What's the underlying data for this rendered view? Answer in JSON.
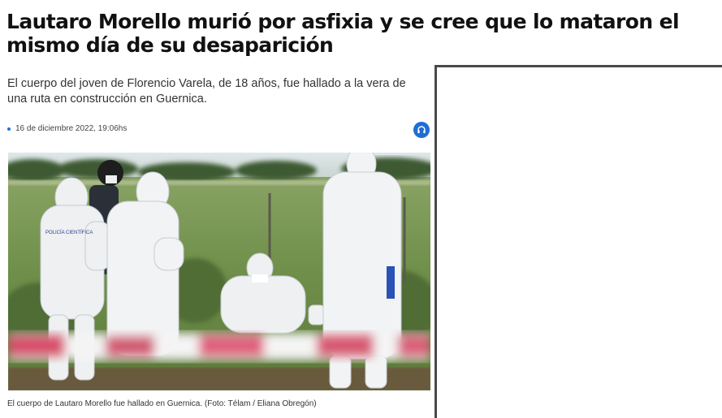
{
  "article": {
    "headline": "Lautaro Morello murió por asfixia y se cree que lo mataron el mismo día de su desaparición",
    "subheadline": "El cuerpo del joven de Florencio Varela, de 18 años, fue hallado a la vera de una ruta en construcción en Guernica.",
    "date": "16 de diciembre 2022, 19:06hs",
    "audio_icon": "headphones-icon",
    "image": {
      "caption": "El cuerpo de Lautaro Morello fue hallado en Guernica. (Foto: Télam / Eliana Obregón)",
      "vest_text": "POLICÍA CIENTÍFICA"
    }
  },
  "colors": {
    "accent": "#1f6ed4",
    "panel_border": "#4a4a4a"
  }
}
